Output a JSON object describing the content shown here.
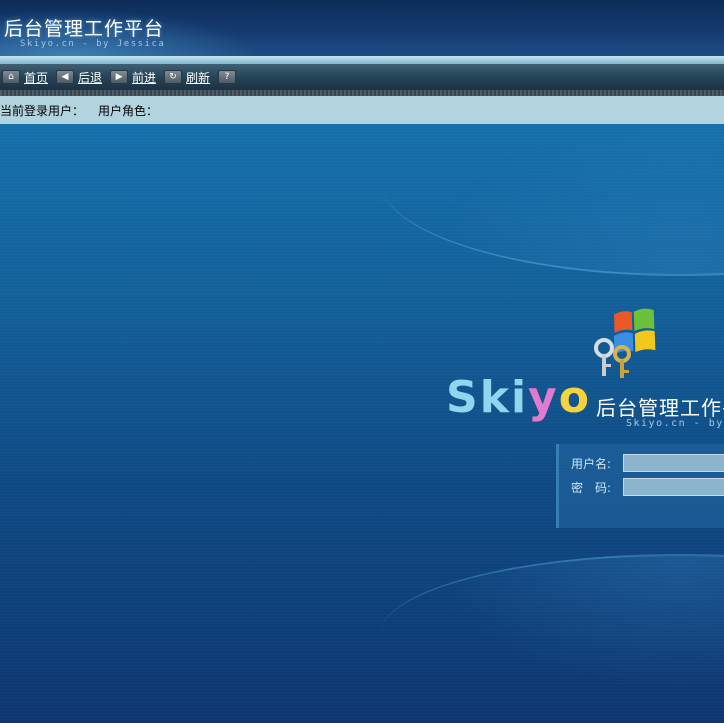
{
  "header": {
    "title": "后台管理工作平台",
    "subtitle": "Skiyo.cn - by Jessica"
  },
  "toolbar": {
    "items": [
      {
        "icon": "home-icon",
        "label": "首页"
      },
      {
        "icon": "back-arrow-icon",
        "label": "后退"
      },
      {
        "icon": "forward-arrow-icon",
        "label": "前进"
      },
      {
        "icon": "refresh-icon",
        "label": "刷新"
      },
      {
        "icon": "help-icon",
        "label": ""
      }
    ]
  },
  "userbar": {
    "current_user_label": "当前登录用户：",
    "role_label": "用户角色："
  },
  "brand": {
    "logo_part1": "Ski",
    "logo_part2": "y",
    "logo_part3": "o",
    "title": "后台管理工作平台",
    "subtitle": "Skiyo.cn - by Jessica"
  },
  "login": {
    "username_label": "用户名:",
    "username_value": "",
    "password_label": "密　码:",
    "password_value": ""
  },
  "colors": {
    "userbar_bg": "#b2d4de",
    "main_bg": "#135f99"
  }
}
